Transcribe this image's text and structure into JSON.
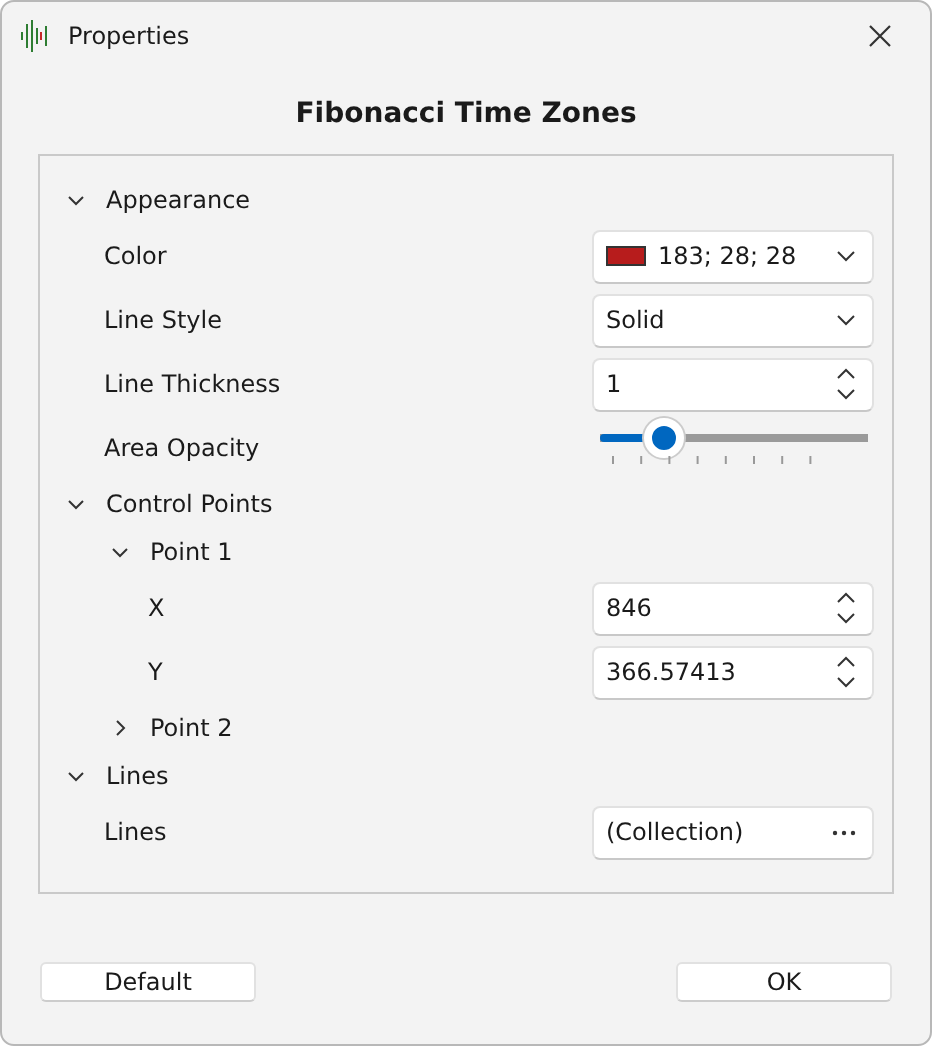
{
  "window": {
    "title": "Properties"
  },
  "heading": "Fibonacci Time Zones",
  "properties": [
    {
      "kind": "category",
      "label": "Appearance",
      "expanded": true,
      "children": [
        {
          "kind": "color",
          "label": "Color",
          "value": "183; 28; 28",
          "color": "#b71c1c"
        },
        {
          "kind": "dropdown",
          "label": "Line Style",
          "value": "Solid"
        },
        {
          "kind": "spinner",
          "label": "Line Thickness",
          "value": "1"
        },
        {
          "kind": "slider",
          "label": "Area Opacity",
          "level": 0.24
        }
      ]
    },
    {
      "kind": "category",
      "label": "Control Points",
      "expanded": true,
      "children": [
        {
          "kind": "category",
          "label": "Point 1",
          "expanded": true,
          "children": [
            {
              "kind": "spinner",
              "label": "X",
              "value": "846"
            },
            {
              "kind": "spinner",
              "label": "Y",
              "value": "366.57413"
            }
          ]
        },
        {
          "kind": "category",
          "label": "Point 2",
          "expanded": false
        }
      ]
    },
    {
      "kind": "category",
      "label": "Lines",
      "expanded": true,
      "children": [
        {
          "kind": "collection",
          "label": "Lines",
          "value": "(Collection)"
        }
      ]
    }
  ],
  "buttons": [
    "Default",
    "OK"
  ]
}
